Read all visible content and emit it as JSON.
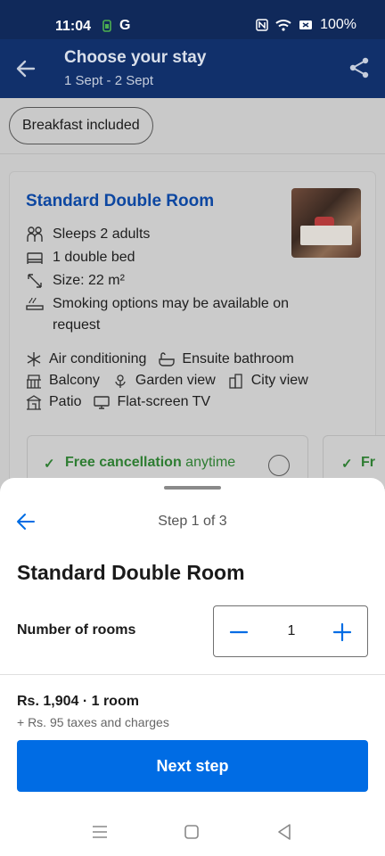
{
  "status_bar": {
    "time": "11:04",
    "carrier_icon": "G",
    "battery": "100%"
  },
  "app_bar": {
    "title": "Choose your stay",
    "dates": "1 Sept - 2 Sept"
  },
  "filter_chip": "Breakfast included",
  "room_card": {
    "title": "Standard Double Room",
    "features": [
      {
        "icon": "people-icon",
        "text": "Sleeps 2 adults"
      },
      {
        "icon": "bed-icon",
        "text": "1 double bed"
      },
      {
        "icon": "size-icon",
        "text": "Size: 22 m²"
      },
      {
        "icon": "smoking-icon",
        "text": "Smoking options may be available on request"
      }
    ],
    "amenities": [
      [
        {
          "icon": "snowflake-icon",
          "text": "Air conditioning"
        },
        {
          "icon": "bathtub-icon",
          "text": "Ensuite bathroom"
        }
      ],
      [
        {
          "icon": "balcony-icon",
          "text": "Balcony"
        },
        {
          "icon": "flower-icon",
          "text": "Garden view"
        },
        {
          "icon": "city-icon",
          "text": "City view"
        }
      ],
      [
        {
          "icon": "patio-icon",
          "text": "Patio"
        },
        {
          "icon": "tv-icon",
          "text": "Flat-screen TV"
        }
      ]
    ],
    "policy_bold": "Free cancellation",
    "policy_rest": " anytime",
    "policy_peek": "Fr"
  },
  "sheet": {
    "step": "Step 1 of 3",
    "title": "Standard Double Room",
    "rooms_label": "Number of rooms",
    "quantity": "1",
    "price": "Rs. 1,904 · 1 room",
    "taxes": "+ Rs. 95 taxes and charges",
    "next_button": "Next step"
  },
  "colors": {
    "header": "#11306b",
    "accent": "#006ce4",
    "link": "#0d47a1",
    "success": "#2e7d32"
  }
}
